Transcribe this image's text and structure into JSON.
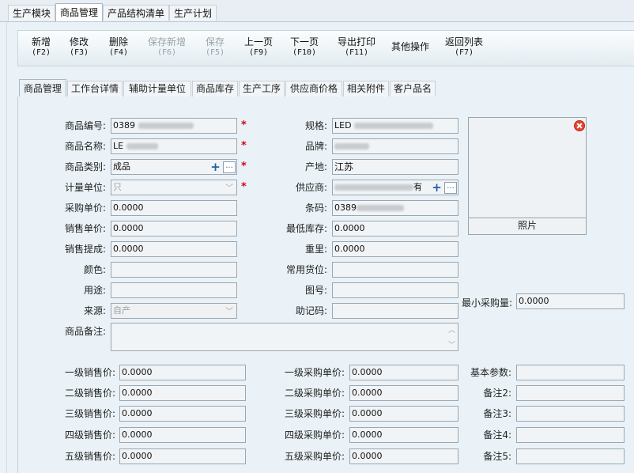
{
  "module_tabs": [
    "生产模块",
    "商品管理",
    "产品结构清单",
    "生产计划"
  ],
  "toolbar": [
    {
      "label": "新增",
      "key": "(F2)",
      "enabled": true
    },
    {
      "label": "修改",
      "key": "(F3)",
      "enabled": true
    },
    {
      "label": "删除",
      "key": "(F4)",
      "enabled": true
    },
    {
      "label": "保存新增",
      "key": "(F6)",
      "enabled": false
    },
    {
      "label": "保存",
      "key": "(F5)",
      "enabled": false
    },
    {
      "label": "上一页",
      "key": "(F9)",
      "enabled": true
    },
    {
      "label": "下一页",
      "key": "(F10)",
      "enabled": true
    },
    {
      "label": "导出打印",
      "key": "(F11)",
      "enabled": true
    },
    {
      "label": "其他操作",
      "key": "",
      "enabled": true
    },
    {
      "label": "返回列表",
      "key": "(F7)",
      "enabled": true
    }
  ],
  "sub_tabs": [
    "商品管理",
    "工作台详情",
    "辅助计量单位",
    "商品库存",
    "生产工序",
    "供应商价格",
    "相关附件",
    "客户品名"
  ],
  "form": {
    "product_code_label": "商品编号:",
    "product_code": "0389",
    "product_name_label": "商品名称:",
    "product_name": "LE",
    "category_label": "商品类别:",
    "category": "成品",
    "unit_label": "计量单位:",
    "unit": "只",
    "purchase_price_label": "采购单价:",
    "purchase_price": "0.0000",
    "sale_price_label": "销售单价:",
    "sale_price": "0.0000",
    "commission_label": "销售提成:",
    "commission": "0.0000",
    "color_label": "颜色:",
    "color": "",
    "usage_label": "用途:",
    "usage": "",
    "source_label": "来源:",
    "source": "自产",
    "remark_label": "商品备注:",
    "remark": "",
    "spec_label": "规格:",
    "spec": "LED",
    "brand_label": "品牌:",
    "brand": "",
    "origin_label": "产地:",
    "origin": "江苏",
    "supplier_label": "供应商:",
    "supplier": "有",
    "barcode_label": "条码:",
    "barcode": "0389",
    "min_stock_label": "最低库存:",
    "min_stock": "0.0000",
    "weight_label": "重里:",
    "weight": "0.0000",
    "location_label": "常用货位:",
    "location": "",
    "drawing_label": "图号:",
    "drawing": "",
    "mnemonic_label": "助记码:",
    "mnemonic": "",
    "photo_label": "照片",
    "min_purchase_label": "最小采购量:",
    "min_purchase": "0.0000"
  },
  "levels": {
    "sale_labels": [
      "一级销售价:",
      "二级销售价:",
      "三级销售价:",
      "四级销售价:",
      "五级销售价:"
    ],
    "sale_values": [
      "0.0000",
      "0.0000",
      "0.0000",
      "0.0000",
      "0.0000"
    ],
    "purchase_labels": [
      "一级采购单价:",
      "二级采购单价:",
      "三级采购单价:",
      "四级采购单价:",
      "五级采购单价:"
    ],
    "purchase_values": [
      "0.0000",
      "0.0000",
      "0.0000",
      "0.0000",
      "0.0000"
    ],
    "extra_labels": [
      "基本参数:",
      "备注2:",
      "备注3:",
      "备注4:",
      "备注5:"
    ],
    "extra_values": [
      "",
      "",
      "",
      "",
      ""
    ]
  }
}
